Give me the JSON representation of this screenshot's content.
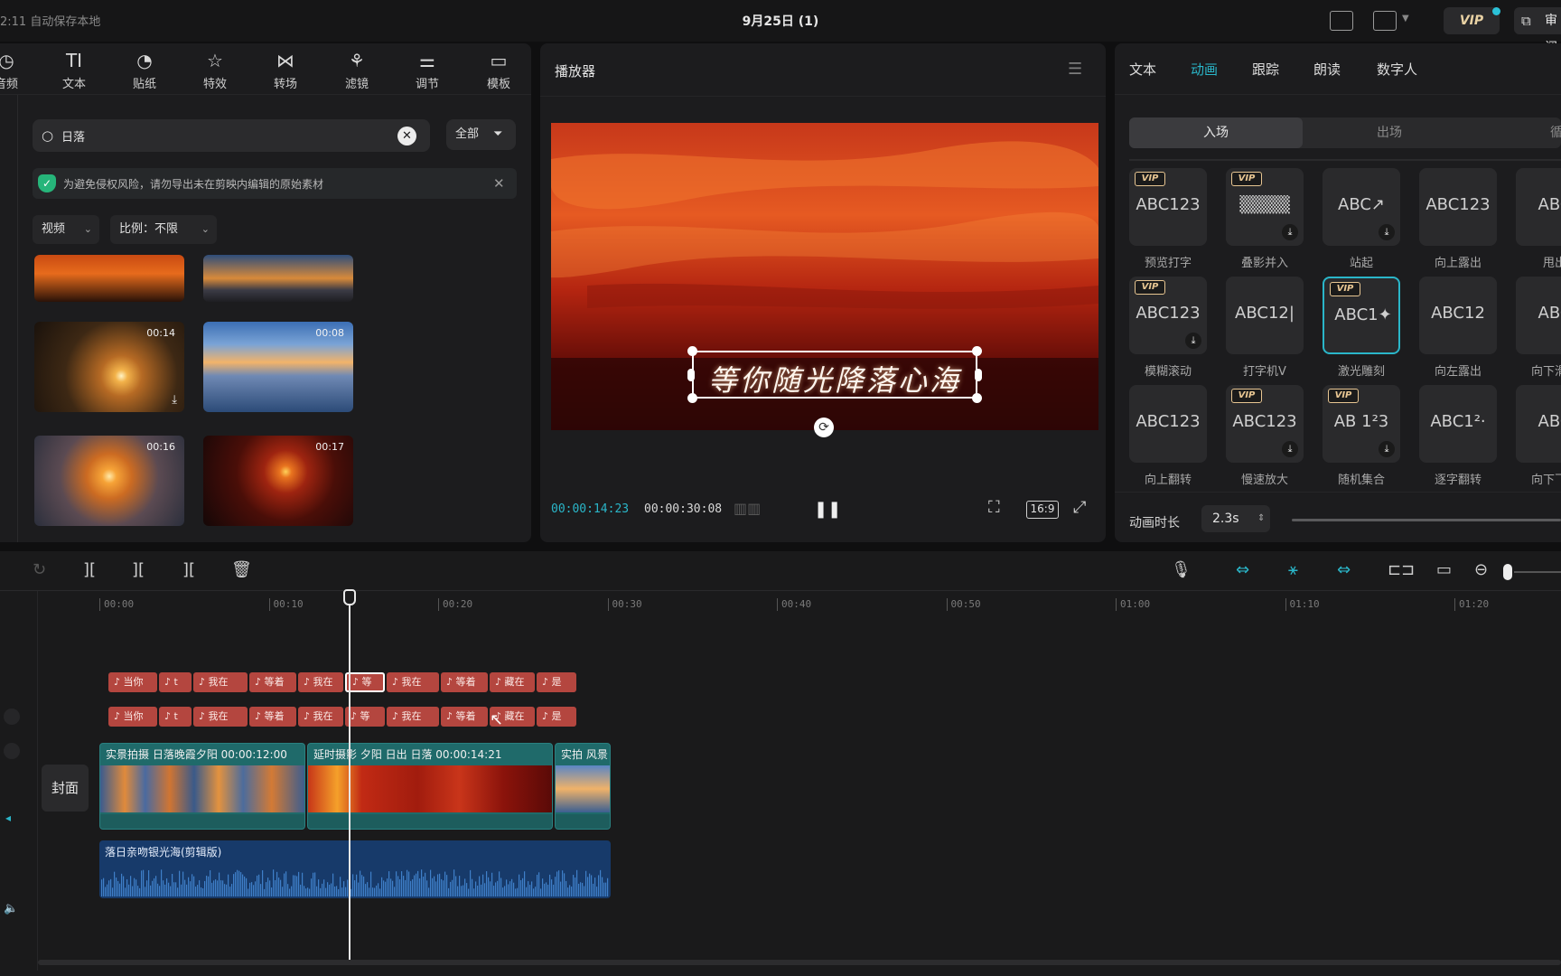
{
  "topbar": {
    "autosave": "2:11 自动保存本地",
    "title": "9月25日 (1)",
    "vip_label": "VIP",
    "review_label": "审阅"
  },
  "toolbar": {
    "items": [
      {
        "label": "音频",
        "icon": "audio-icon"
      },
      {
        "label": "文本",
        "icon": "text-icon"
      },
      {
        "label": "贴纸",
        "icon": "sticker-icon"
      },
      {
        "label": "特效",
        "icon": "effects-icon"
      },
      {
        "label": "转场",
        "icon": "transition-icon"
      },
      {
        "label": "滤镜",
        "icon": "filter-icon"
      },
      {
        "label": "调节",
        "icon": "adjust-icon"
      },
      {
        "label": "模板",
        "icon": "template-icon"
      }
    ]
  },
  "search": {
    "value": "日落",
    "filter_label": "全部"
  },
  "notice": {
    "text": "为避免侵权风险，请勿导出未在剪映内编辑的原始素材"
  },
  "filters": {
    "type": "视频",
    "ratio": "比例：不限"
  },
  "media": [
    {
      "duration": ""
    },
    {
      "duration": ""
    },
    {
      "duration": "00:14"
    },
    {
      "duration": "00:08"
    },
    {
      "duration": "00:16"
    },
    {
      "duration": "00:17"
    }
  ],
  "player": {
    "title": "播放器",
    "caption": "等你随光降落心海",
    "current_time": "00:00:14:23",
    "total_time": "00:00:30:08",
    "ratio": "16:9"
  },
  "right_panel": {
    "tabs": [
      "文本",
      "动画",
      "跟踪",
      "朗读",
      "数字人"
    ],
    "active_tab": "动画",
    "subtabs": {
      "in": "入场",
      "out": "出场",
      "loop": "循"
    },
    "animations": [
      {
        "label": "预览打字",
        "preview": "ABC123",
        "vip": true,
        "download": false
      },
      {
        "label": "叠影并入",
        "preview": "▒▒▒▒",
        "vip": true,
        "download": true
      },
      {
        "label": "站起",
        "preview": "ABC↗",
        "vip": false,
        "download": true
      },
      {
        "label": "向上露出",
        "preview": "ABC123",
        "vip": false,
        "download": false
      },
      {
        "label": "甩出",
        "preview": "ABC",
        "vip": false,
        "download": false
      },
      {
        "label": "模糊滚动",
        "preview": "ABC123",
        "vip": true,
        "download": true
      },
      {
        "label": "打字机V",
        "preview": "ABC12|",
        "vip": false,
        "download": false
      },
      {
        "label": "激光雕刻",
        "preview": "ABC1✦",
        "vip": true,
        "download": false
      },
      {
        "label": "向左露出",
        "preview": "ABC12",
        "vip": false,
        "download": false
      },
      {
        "label": "向下滑动",
        "preview": "ABC",
        "vip": false,
        "download": false
      },
      {
        "label": "向上翻转",
        "preview": "ABC123",
        "vip": false,
        "download": false
      },
      {
        "label": "慢速放大",
        "preview": "ABC123",
        "vip": true,
        "download": true
      },
      {
        "label": "随机集合",
        "preview": "AB 1²3",
        "vip": true,
        "download": true
      },
      {
        "label": "逐字翻转",
        "preview": "ABC1²·",
        "vip": false,
        "download": false
      },
      {
        "label": "向下飞入",
        "preview": "ABC",
        "vip": false,
        "download": false
      }
    ],
    "duration_label": "动画时长",
    "duration_value": "2.3s"
  },
  "timeline": {
    "ruler": [
      "00:00",
      "00:10",
      "00:20",
      "00:30",
      "00:40",
      "00:50",
      "01:00",
      "01:10",
      "01:20"
    ],
    "subtitles_row1": [
      "当你",
      "t",
      "我在",
      "等着",
      "我在",
      "等",
      "我在",
      "等着",
      "藏在",
      "是"
    ],
    "subtitles_row2": [
      "当你",
      "t",
      "我在",
      "等着",
      "我在",
      "等",
      "我在",
      "等着",
      "藏在",
      "是"
    ],
    "cover_label": "封面",
    "video_clips": [
      {
        "label": "实景拍摄 日落晚霞夕阳  00:00:12:00"
      },
      {
        "label": "延时摄影 夕阳 日出 日落  00:00:14:21"
      },
      {
        "label": "实拍 风景"
      }
    ],
    "audio_label": "落日亲吻银光海(剪辑版)"
  },
  "colors": {
    "accent": "#2ab6c9",
    "subtitle_clip": "#b4463f",
    "video_clip": "#1f6a6a",
    "audio_clip": "#173a6a"
  }
}
